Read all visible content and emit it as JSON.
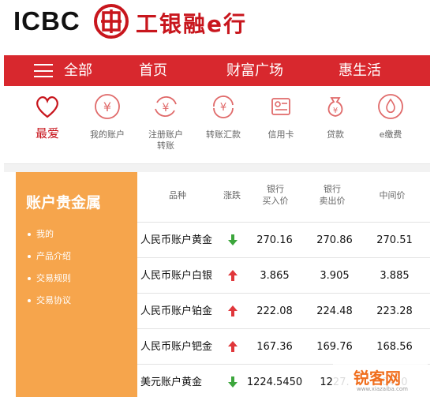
{
  "header": {
    "brand_en": "ICBC",
    "brand_cn": "工银融e行"
  },
  "nav": {
    "items": [
      "全部",
      "首页",
      "财富广场",
      "惠生活"
    ]
  },
  "quick": {
    "items": [
      {
        "label": "最爱",
        "icon": "heart-icon"
      },
      {
        "label": "我的账户",
        "icon": "yen-icon"
      },
      {
        "label": "注册账户\n转账",
        "icon": "yen-exchange-icon"
      },
      {
        "label": "转账汇款",
        "icon": "transfer-icon"
      },
      {
        "label": "信用卡",
        "icon": "credit-card-icon"
      },
      {
        "label": "贷款",
        "icon": "money-bag-icon"
      },
      {
        "label": "e缴费",
        "icon": "drop-icon"
      }
    ]
  },
  "sidebar": {
    "title": "账户贵金属",
    "items": [
      "我的",
      "产品介绍",
      "交易规则",
      "交易协议"
    ]
  },
  "table": {
    "headers": [
      "品种",
      "涨跌",
      "银行\n买入价",
      "银行\n卖出价",
      "中间价"
    ],
    "rows": [
      {
        "name": "人民币账户黄金",
        "trend": "down",
        "buy": "270.16",
        "sell": "270.86",
        "mid": "270.51"
      },
      {
        "name": "人民币账户白银",
        "trend": "up",
        "buy": "3.865",
        "sell": "3.905",
        "mid": "3.885"
      },
      {
        "name": "人民币账户铂金",
        "trend": "up",
        "buy": "222.08",
        "sell": "224.48",
        "mid": "223.28"
      },
      {
        "name": "人民币账户钯金",
        "trend": "up",
        "buy": "167.36",
        "sell": "169.76",
        "mid": "168.56"
      },
      {
        "name": "美元账户黄金",
        "trend": "down",
        "buy": "1224.5450",
        "sell": "1227.",
        "mid": "0450"
      }
    ]
  },
  "watermark": {
    "text": "锐客网",
    "sub": "www.xiazaiba.com"
  },
  "colors": {
    "brand_red": "#d8282e",
    "sidebar_orange": "#f6a54c",
    "up": "#e0373b",
    "down": "#3ca63c"
  }
}
